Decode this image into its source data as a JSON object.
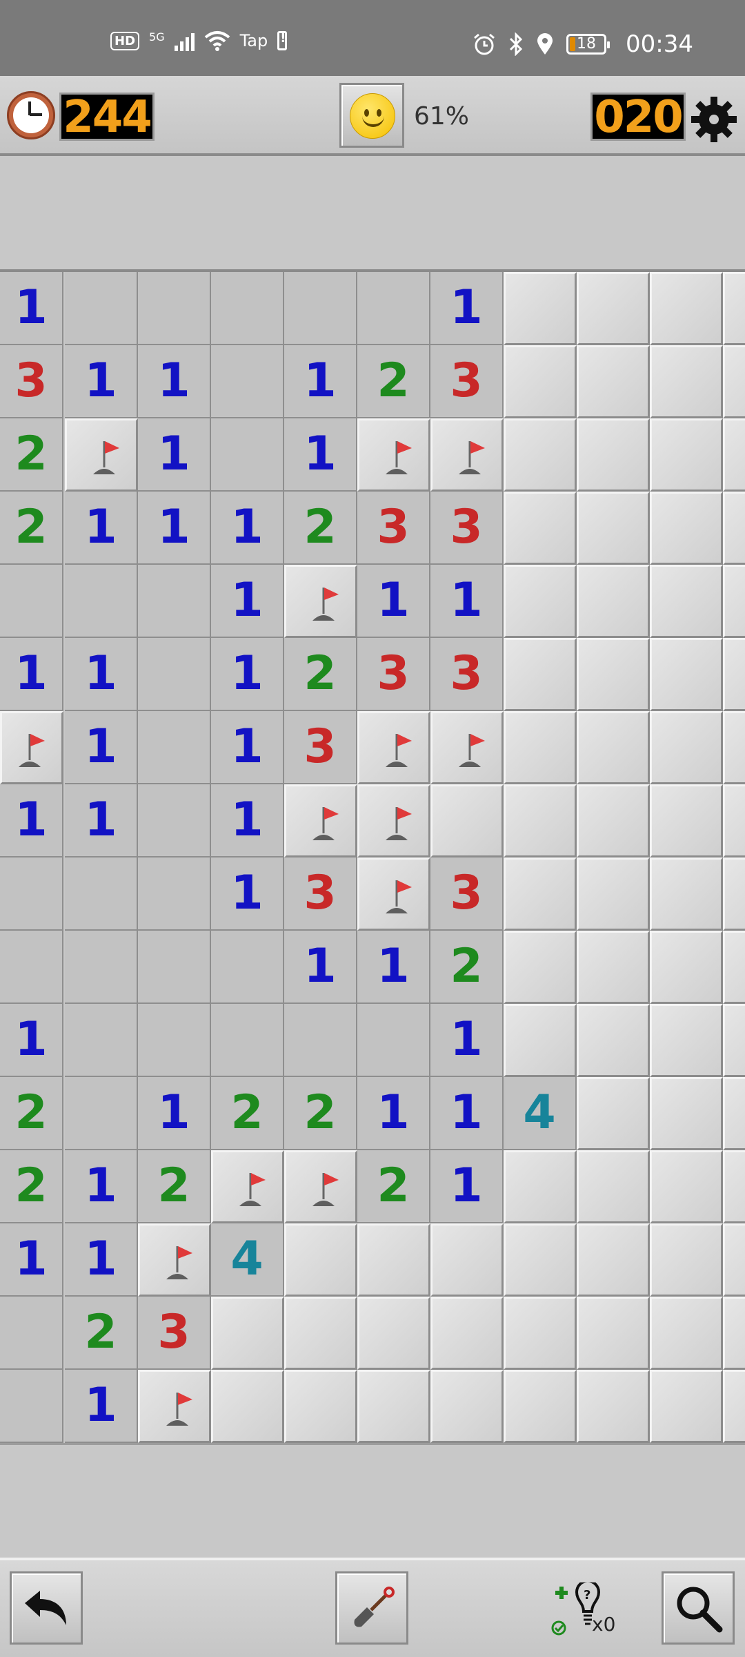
{
  "status_bar": {
    "hd": "HD",
    "network": "5G",
    "wifi_label": "Tap",
    "battery_level": "18",
    "time": "00:34"
  },
  "header": {
    "timer": "244",
    "progress": "61%",
    "mines_left": "020",
    "face_icon": "smiley-icon",
    "settings_icon": "gear-icon",
    "clock_icon": "clock-icon"
  },
  "colors": {
    "one": "#1212c4",
    "two": "#1e8a1e",
    "three": "#c82828",
    "four": "#17849a",
    "digits": "#f2a01b"
  },
  "board": {
    "rows": [
      "1_____1####",
      "311_123####",
      "2F1_1FF####",
      "2111233####",
      "___1F11####",
      "11_1233####",
      "F1_13FF####",
      "11_1FF#####",
      "___13F3####",
      "____112####",
      "1_____1####",
      "2_122114###",
      "212FF21####",
      "11F4#######",
      "_23########",
      "_1F########"
    ],
    "legend": "digit = revealed number, _ = revealed empty, F = flagged, # = covered"
  },
  "toolbar": {
    "undo_icon": "undo-arrow-icon",
    "dig_icon": "shovel-icon",
    "hint_icon": "hint-lightbulb-icon",
    "hint_count": "x0",
    "zoom_icon": "magnifier-icon"
  }
}
